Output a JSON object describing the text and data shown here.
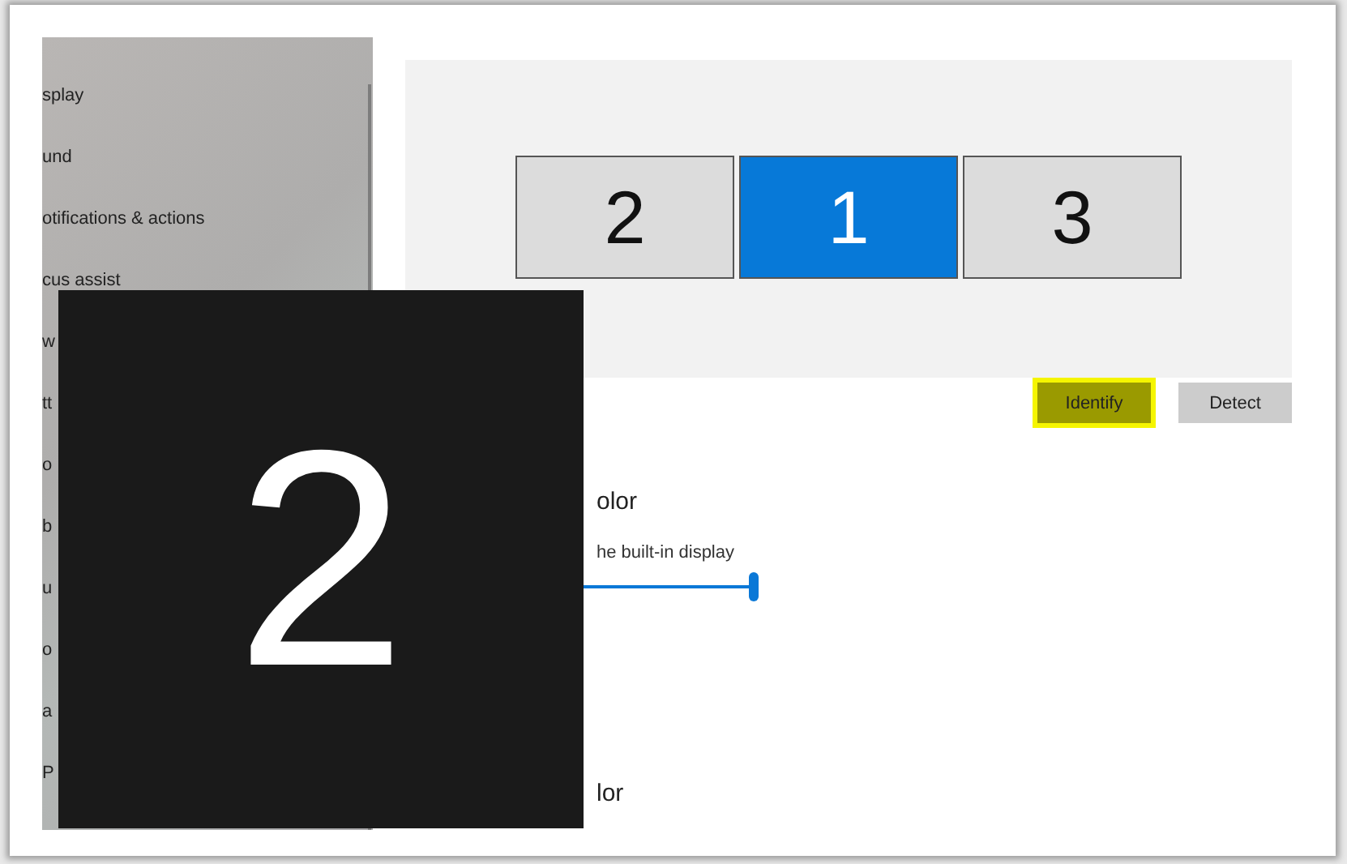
{
  "sidebar": {
    "items": [
      {
        "label": "splay"
      },
      {
        "label": "und"
      },
      {
        "label": "otifications & actions"
      },
      {
        "label": "cus assist"
      },
      {
        "label": "w"
      },
      {
        "label": "tt"
      },
      {
        "label": "o"
      },
      {
        "label": "b"
      },
      {
        "label": "u"
      },
      {
        "label": "o"
      },
      {
        "label": "a"
      },
      {
        "label": "P"
      }
    ]
  },
  "arrangement": {
    "monitors": [
      {
        "number": "2",
        "selected": false
      },
      {
        "number": "1",
        "selected": true
      },
      {
        "number": "3",
        "selected": false
      }
    ]
  },
  "buttons": [
    {
      "label": "Identify",
      "highlighted": true
    },
    {
      "label": "Detect",
      "highlighted": false
    }
  ],
  "brightness": {
    "heading": "olor",
    "label": "he built-in display",
    "level": 1
  },
  "night_light": {
    "heading": "lor"
  },
  "identify_overlay": {
    "number": "2"
  }
}
